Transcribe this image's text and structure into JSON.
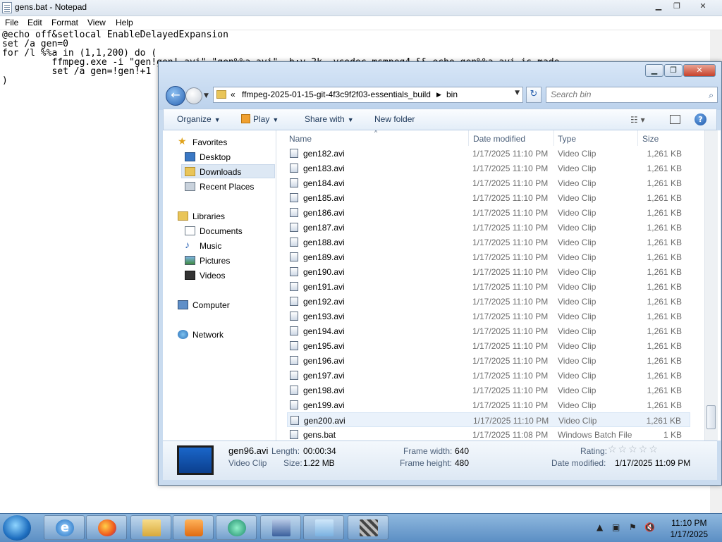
{
  "notepad": {
    "title": "gens.bat - Notepad",
    "menu": [
      "File",
      "Edit",
      "Format",
      "View",
      "Help"
    ],
    "lines": [
      "@echo off&setlocal EnableDelayedExpansion",
      "set /a gen=0",
      "for /l %%a in (1,1,200) do (",
      "         ffmpeg.exe -i \"gen!gen!.avi\" \"gen%%a.avi\" -b:v 2k -vcodec msmpeg4 && echo gen%%a.avi is made",
      "         set /a gen=!gen!+1",
      ")"
    ]
  },
  "explorer": {
    "address": {
      "chevron": "«",
      "crumbs": [
        "ffmpeg-2025-01-15-git-4f3c9f2f03-essentials_build",
        "bin"
      ]
    },
    "search_placeholder": "Search bin",
    "toolbar": {
      "organize": "Organize",
      "play": "Play",
      "share": "Share with",
      "new_folder": "New folder"
    },
    "nav": {
      "favorites": "Favorites",
      "desktop": "Desktop",
      "downloads": "Downloads",
      "recent": "Recent Places",
      "libraries": "Libraries",
      "documents": "Documents",
      "music": "Music",
      "pictures": "Pictures",
      "videos": "Videos",
      "computer": "Computer",
      "network": "Network"
    },
    "columns": {
      "name": "Name",
      "date": "Date modified",
      "type": "Type",
      "size": "Size"
    },
    "files": [
      {
        "name": "gen182.avi",
        "date": "1/17/2025 11:10 PM",
        "type": "Video Clip",
        "size": "1,261 KB"
      },
      {
        "name": "gen183.avi",
        "date": "1/17/2025 11:10 PM",
        "type": "Video Clip",
        "size": "1,261 KB"
      },
      {
        "name": "gen184.avi",
        "date": "1/17/2025 11:10 PM",
        "type": "Video Clip",
        "size": "1,261 KB"
      },
      {
        "name": "gen185.avi",
        "date": "1/17/2025 11:10 PM",
        "type": "Video Clip",
        "size": "1,261 KB"
      },
      {
        "name": "gen186.avi",
        "date": "1/17/2025 11:10 PM",
        "type": "Video Clip",
        "size": "1,261 KB"
      },
      {
        "name": "gen187.avi",
        "date": "1/17/2025 11:10 PM",
        "type": "Video Clip",
        "size": "1,261 KB"
      },
      {
        "name": "gen188.avi",
        "date": "1/17/2025 11:10 PM",
        "type": "Video Clip",
        "size": "1,261 KB"
      },
      {
        "name": "gen189.avi",
        "date": "1/17/2025 11:10 PM",
        "type": "Video Clip",
        "size": "1,261 KB"
      },
      {
        "name": "gen190.avi",
        "date": "1/17/2025 11:10 PM",
        "type": "Video Clip",
        "size": "1,261 KB"
      },
      {
        "name": "gen191.avi",
        "date": "1/17/2025 11:10 PM",
        "type": "Video Clip",
        "size": "1,261 KB"
      },
      {
        "name": "gen192.avi",
        "date": "1/17/2025 11:10 PM",
        "type": "Video Clip",
        "size": "1,261 KB"
      },
      {
        "name": "gen193.avi",
        "date": "1/17/2025 11:10 PM",
        "type": "Video Clip",
        "size": "1,261 KB"
      },
      {
        "name": "gen194.avi",
        "date": "1/17/2025 11:10 PM",
        "type": "Video Clip",
        "size": "1,261 KB"
      },
      {
        "name": "gen195.avi",
        "date": "1/17/2025 11:10 PM",
        "type": "Video Clip",
        "size": "1,261 KB"
      },
      {
        "name": "gen196.avi",
        "date": "1/17/2025 11:10 PM",
        "type": "Video Clip",
        "size": "1,261 KB"
      },
      {
        "name": "gen197.avi",
        "date": "1/17/2025 11:10 PM",
        "type": "Video Clip",
        "size": "1,261 KB"
      },
      {
        "name": "gen198.avi",
        "date": "1/17/2025 11:10 PM",
        "type": "Video Clip",
        "size": "1,261 KB"
      },
      {
        "name": "gen199.avi",
        "date": "1/17/2025 11:10 PM",
        "type": "Video Clip",
        "size": "1,261 KB"
      },
      {
        "name": "gen200.avi",
        "date": "1/17/2025 11:10 PM",
        "type": "Video Clip",
        "size": "1,261 KB"
      },
      {
        "name": "gens.bat",
        "date": "1/17/2025 11:08 PM",
        "type": "Windows Batch File",
        "size": "1 KB"
      }
    ],
    "details": {
      "filename": "gen96.avi",
      "filetype": "Video Clip",
      "length_label": "Length:",
      "length": "00:00:34",
      "size_label": "Size:",
      "size": "1.22 MB",
      "fwidth_label": "Frame width:",
      "fwidth": "640",
      "fheight_label": "Frame height:",
      "fheight": "480",
      "rating_label": "Rating:",
      "modified_label": "Date modified:",
      "modified": "1/17/2025 11:09 PM"
    }
  },
  "taskbar": {
    "time": "11:10 PM",
    "date": "1/17/2025"
  },
  "icons": {
    "start": "windows-start-orb",
    "pinned": [
      "internet-explorer",
      "firefox",
      "file-explorer",
      "media-player",
      "media-center",
      "network-tool",
      "notepad",
      "ffmpeg-app"
    ]
  }
}
